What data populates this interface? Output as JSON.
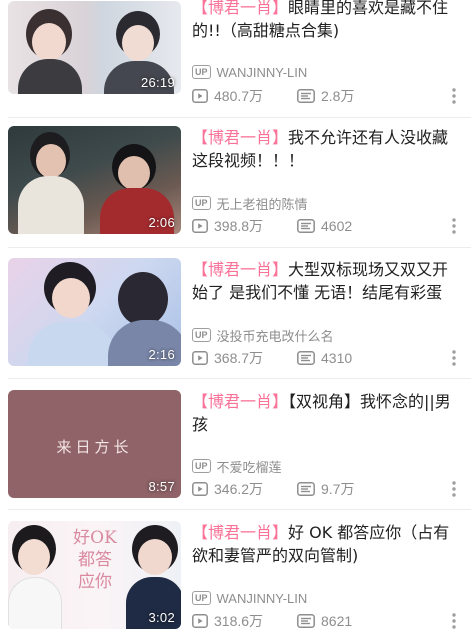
{
  "icons": {
    "play_count": "play-count-icon",
    "danmaku": "danmaku-icon",
    "more": "more-menu-icon",
    "uploader": "up-badge"
  },
  "colors": {
    "accent": "#fb7299",
    "meta_text": "#8e8e8e",
    "title_text": "#212121"
  },
  "videos": [
    {
      "tag": "",
      "title": "眼睛里的喜欢是藏不住的!!（高甜糖点合集)",
      "title_prefix": "【博君一肖】",
      "up_badge": "UP",
      "uploader": "WANJINNY-LIN",
      "views": "480.7万",
      "danmaku": "2.8万",
      "duration": "26:19"
    },
    {
      "title_prefix": "【博君一肖】",
      "title": "我不允许还有人没收藏这段视频！！！",
      "up_badge": "UP",
      "uploader": "无上老祖的陈情",
      "views": "398.8万",
      "danmaku": "4602",
      "duration": "2:06"
    },
    {
      "title_prefix": "【博君一肖】",
      "title": "大型双标现场又双又开始了 是我们不懂 无语！结尾有彩蛋",
      "up_badge": "UP",
      "uploader": "没投币充电改什么名",
      "views": "368.7万",
      "danmaku": "4310",
      "duration": "2:16"
    },
    {
      "title_prefix": "【博君一肖】",
      "title": "【双视角】我怀念的||男孩",
      "up_badge": "UP",
      "uploader": "不爱吃榴莲",
      "views": "346.2万",
      "danmaku": "9.7万",
      "duration": "8:57",
      "thumb_text": "来日方长"
    },
    {
      "title_prefix": "【博君一肖】",
      "title": "好 OK 都答应你（占有欲和妻管严的双向管制)",
      "up_badge": "UP",
      "uploader": "WANJINNY-LIN",
      "views": "318.6万",
      "danmaku": "8621",
      "duration": "3:02",
      "thumb_text": "好OK都答应你"
    }
  ]
}
